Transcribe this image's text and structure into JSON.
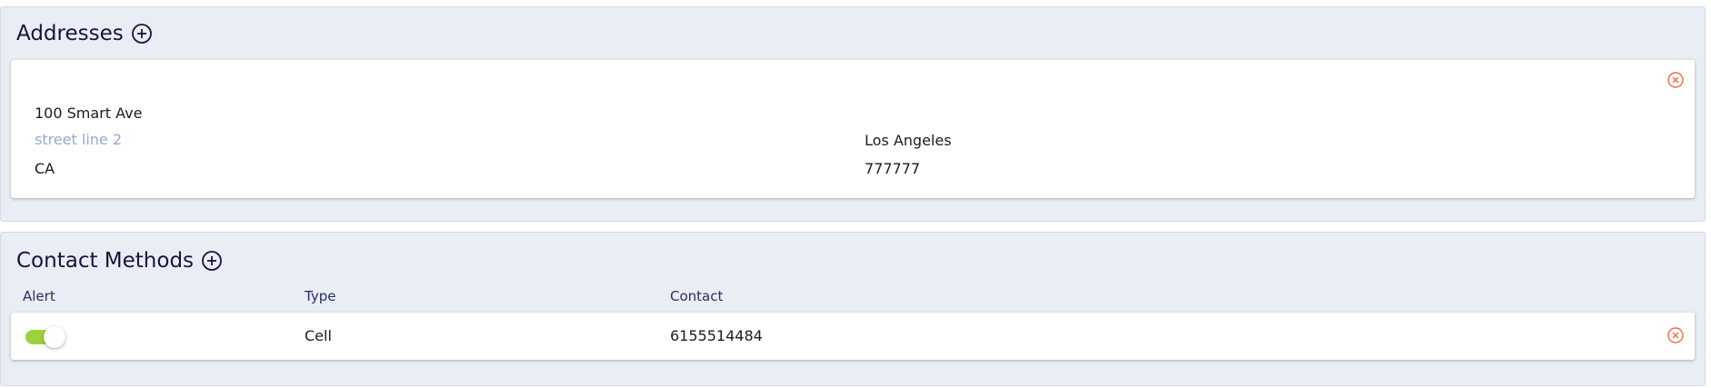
{
  "addresses": {
    "title": "Addresses",
    "icons": {
      "add": "plus-circle-icon",
      "remove": "x-circle-icon"
    },
    "card": {
      "street1": "100 Smart Ave",
      "street2_placeholder": "street line 2",
      "city": "Los Angeles",
      "state": "CA",
      "zip": "777777"
    }
  },
  "contact_methods": {
    "title": "Contact Methods",
    "icons": {
      "add": "plus-circle-icon",
      "remove": "x-circle-icon"
    },
    "columns": {
      "alert": "Alert",
      "type": "Type",
      "contact": "Contact"
    },
    "rows": [
      {
        "alert_enabled": true,
        "type": "Cell",
        "contact": "6155514484"
      }
    ]
  },
  "colors": {
    "section_bg": "#e9edf4",
    "title": "#14163a",
    "toggle_on": "#9ed13f",
    "remove_icon": "#f06c4a",
    "placeholder": "#9aa8cc"
  }
}
